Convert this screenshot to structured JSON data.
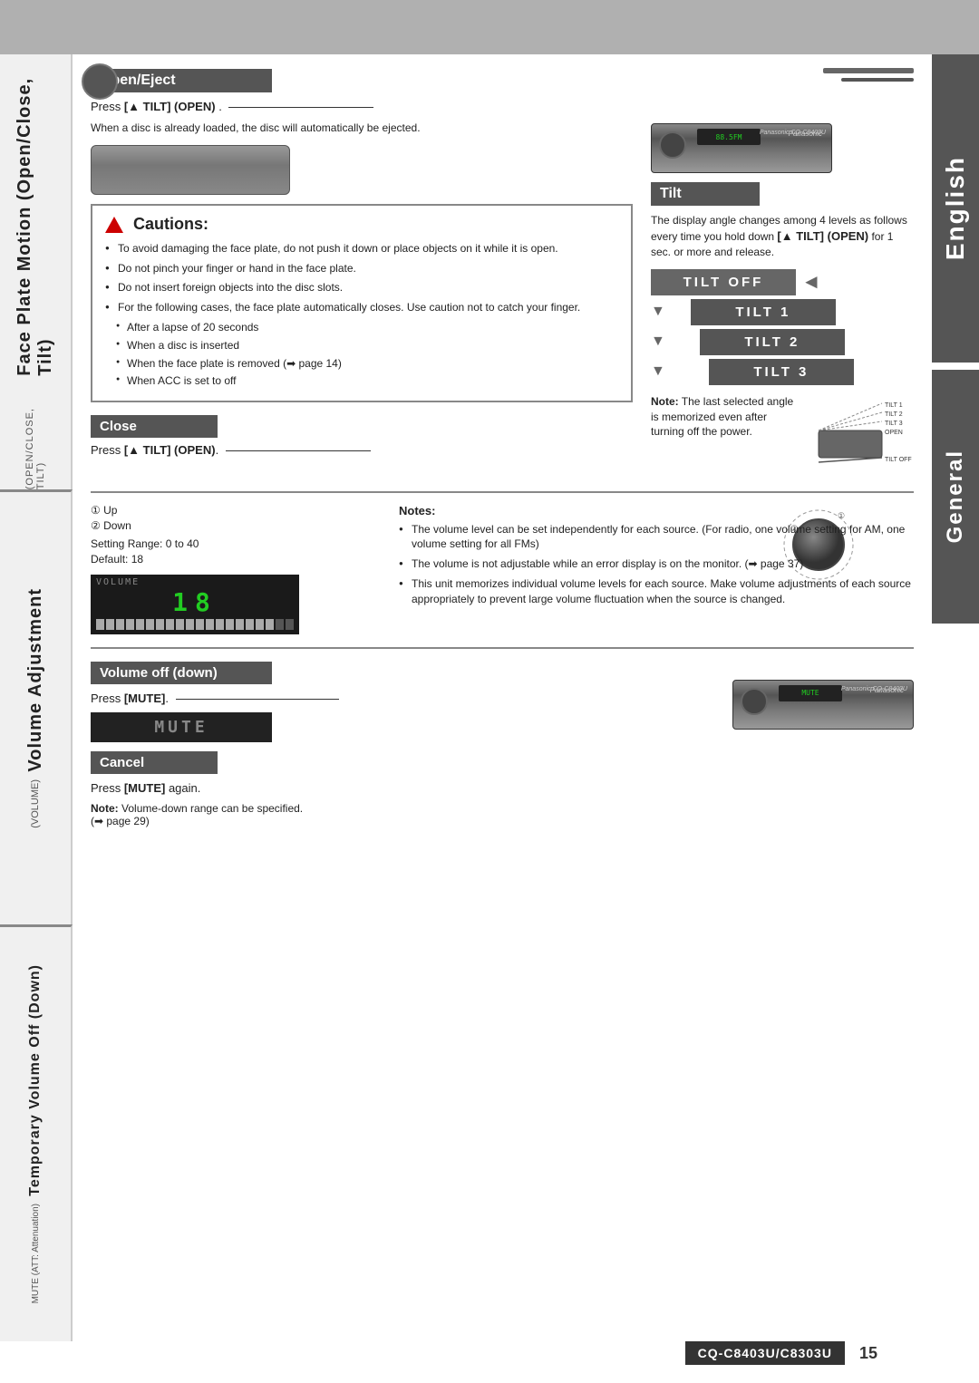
{
  "page": {
    "title": "CQ-C8403U/C8303U",
    "page_number": "15"
  },
  "top_bar": {},
  "right_sidebar": {
    "english_label": "English",
    "general_label": "General"
  },
  "left_sidebar": {
    "section1": {
      "main": "Face Plate Motion (Open/Close, Tilt)",
      "sub": "(OPEN/CLOSE, TILT)"
    },
    "section2": {
      "main": "Volume Adjustment",
      "sub": "(VOLUME)"
    },
    "section3": {
      "main": "Temporary Volume Off (Down)",
      "sub": "MUTE (ATT: Attenuation)"
    }
  },
  "open_eject": {
    "header": "Open/Eject",
    "instruction": "Press [▲ TILT] (OPEN).",
    "description": "When a disc is already loaded, the disc will automatically be ejected."
  },
  "cautions": {
    "title": "Cautions:",
    "items": [
      "To avoid damaging the face plate, do not push it down or place objects on it while it is open.",
      "Do not pinch your finger or hand in the face plate.",
      "Do not insert foreign objects into the disc slots.",
      "For the following cases, the face plate automatically closes. Use caution not to catch your finger."
    ],
    "sub_items": [
      "After a lapse of 20 seconds",
      "When a disc is inserted",
      "When the face plate is removed (➡ page 14)",
      "When ACC is set to off"
    ]
  },
  "tilt": {
    "header": "Tilt",
    "description": "The display angle changes among 4 levels as follows every time you hold down [▲ TILT] (OPEN) for 1 sec. or more and release.",
    "levels": [
      {
        "label": "TILT  OFF",
        "class": "tilt-off"
      },
      {
        "label": "TILT  1",
        "class": "tilt-1"
      },
      {
        "label": "TILT  2",
        "class": "tilt-2"
      },
      {
        "label": "TILT  3",
        "class": "tilt-3"
      }
    ],
    "note_label": "Note:",
    "note_text": "The last selected angle is memorized even after turning off the power.",
    "tilt_labels": [
      "TILT 1",
      "TILT 2",
      "TILT 3",
      "OPEN",
      "TILT OFF"
    ]
  },
  "close": {
    "header": "Close",
    "instruction": "Press [▲ TILT] (OPEN)."
  },
  "volume_adjustment": {
    "header": "Volume Adjustment",
    "up_label": "① Up",
    "down_label": "② Down",
    "setting_range": "Setting Range: 0 to 40",
    "default": "Default: 18",
    "lcd_label": "VOLUME",
    "lcd_value": "18",
    "notes_title": "Notes:",
    "notes": [
      "The volume level can be set independently for each source. (For radio, one volume setting for AM, one volume setting for all FMs)",
      "The volume is not adjustable while an error display is on the monitor. (➡ page 37)",
      "This unit memorizes individual volume levels for each source. Make volume adjustments of each source appropriately to prevent large volume fluctuation when the source is changed."
    ]
  },
  "volume_off": {
    "header": "Volume off (down)",
    "instruction": "Press [MUTE].",
    "mute_display": "MUTE"
  },
  "cancel": {
    "header": "Cancel",
    "instruction": "Press [MUTE] again.",
    "note_label": "Note:",
    "note_text": "Volume-down range can be specified.",
    "note_ref": "(➡ page 29)"
  }
}
